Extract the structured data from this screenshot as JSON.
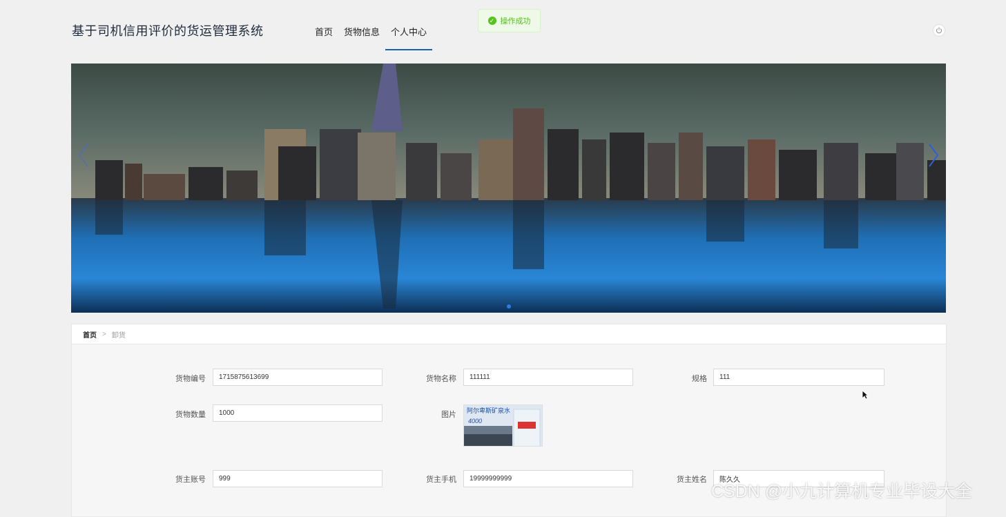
{
  "header": {
    "title": "基于司机信用评价的货运管理系统",
    "nav": [
      "首页",
      "货物信息",
      "个人中心"
    ],
    "active_nav": "个人中心",
    "toast": "操作成功"
  },
  "breadcrumb": {
    "home": "首页",
    "separator": ">",
    "current": "卸货"
  },
  "form": {
    "goods_no_label": "货物编号",
    "goods_no": "1715875613699",
    "goods_name_label": "货物名称",
    "goods_name": "111111",
    "spec_label": "规格",
    "spec": "111",
    "quantity_label": "货物数量",
    "quantity": "1000",
    "image_label": "图片",
    "image_caption": "阿尔卑斯矿泉水",
    "image_sub": "4000",
    "owner_account_label": "货主账号",
    "owner_account": "999",
    "owner_phone_label": "货主手机",
    "owner_phone": "19999999999",
    "owner_name_label": "货主姓名",
    "owner_name": "陈久久"
  },
  "watermark": "CSDN @小九计算机专业毕设大全",
  "colors": {
    "accent": "#1e5fa8",
    "success": "#52c41a"
  }
}
